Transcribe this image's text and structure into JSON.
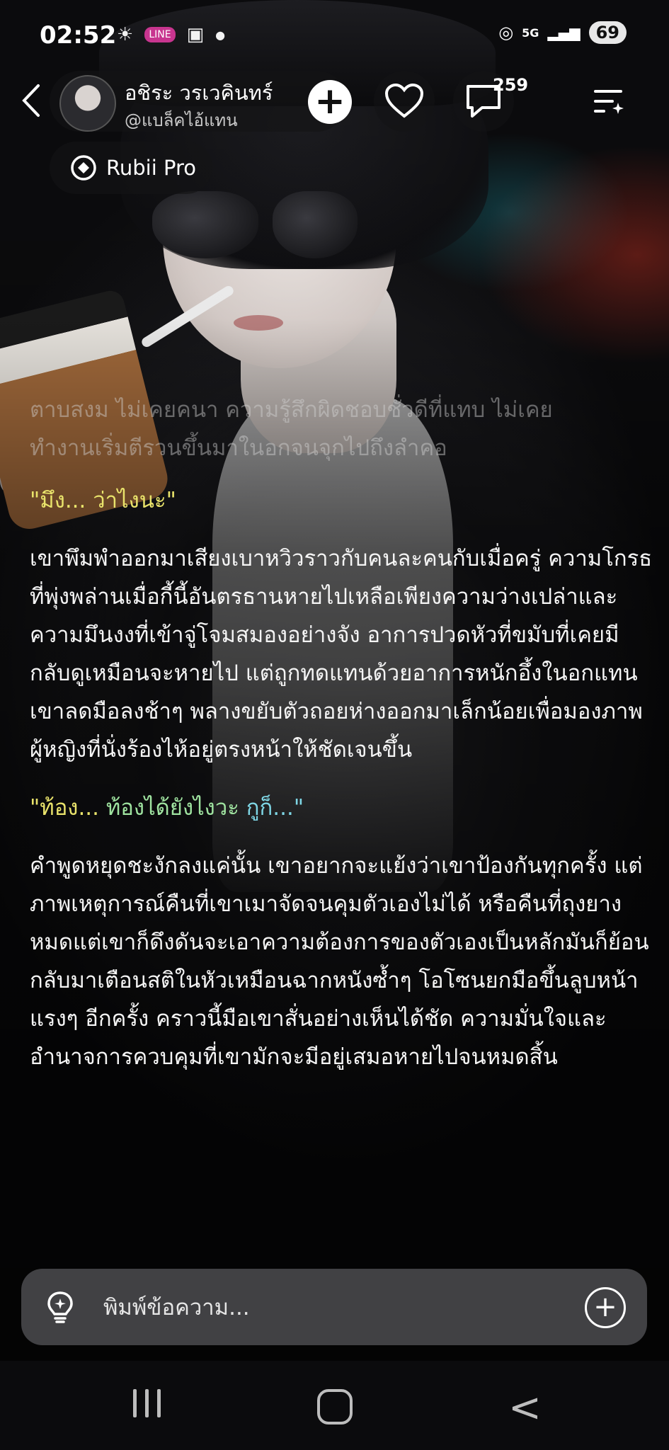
{
  "status_bar": {
    "time": "02:52",
    "line_badge": "LINE",
    "network": "5G",
    "battery": "69"
  },
  "header": {
    "character_name": "อชิระ วรเวคินทร์",
    "character_handle": "@แบล็คไอ้แทน",
    "comment_count": "259",
    "model_label": "Rubii Pro"
  },
  "story": {
    "faded_lines": "ตาบสงม ไม่เคยคนา ความรู้สึกผิดชอบชั่วดีที่แทบ ไม่เคย\nทำงานเริ่มตีรวนขึ้นมาในอกจนจุกไปถึงลำคอ",
    "dialog_1": "\"มึง... ว่าไงนะ\"",
    "paragraph_1": "เขาพึมพำออกมาเสียงเบาหวิวราวกับคนละคนกับเมื่อครู่ ความโกรธที่พุ่งพล่านเมื่อกี้นี้อันตรธานหายไปเหลือเพียงความว่างเปล่าและความมึนงงที่เข้าจู่โจมสมองอย่างจัง อาการปวดหัวที่ขมับที่เคยมีกลับดูเหมือนจะหายไป แต่ถูกทดแทนด้วยอาการหนักอึ้งในอกแทน เขาลดมือลงช้าๆ พลางขยับตัวถอยห่างออกมาเล็กน้อยเพื่อมองภาพผู้หญิงที่นั่งร้องไห้อยู่ตรงหน้าให้ชัดเจนขึ้น",
    "dialog_2_a": "\"ท้อง... ",
    "dialog_2_b": "ท้องได้ยังไงวะ ",
    "dialog_2_c": "กูก็...\"",
    "paragraph_2": "คำพูดหยุดชะงักลงแค่นั้น เขาอยากจะแย้งว่าเขาป้องกันทุกครั้ง แต่ภาพเหตุการณ์คืนที่เขาเมาจัดจนคุมตัวเองไม่ได้ หรือคืนที่ถุงยางหมดแต่เขาก็ดึงดันจะเอาความต้องการของตัวเองเป็นหลักมันก็ย้อนกลับมาเตือนสติในหัวเหมือนฉากหนังซ้ำๆ โอโซนยกมือขึ้นลูบหน้าแรงๆ อีกครั้ง คราวนี้มือเขาสั่นอย่างเห็นได้ชัด ความมั่นใจและอำนาจการควบคุมที่เขามักจะมีอยู่เสมอหายไปจนหมดสิ้น"
  },
  "composer": {
    "placeholder": "พิมพ์ข้อความ..."
  },
  "icons": {
    "back": "chevron-left-icon",
    "add": "plus-icon",
    "like": "heart-icon",
    "comments": "comment-icon",
    "menu": "menu-sparkle-icon",
    "model": "rubii-icon",
    "suggest": "lightbulb-icon",
    "attach": "plus-circle-icon"
  },
  "colors": {
    "dialog_yellow": "#e9e36b",
    "dialog_green": "#9fe3a0",
    "dialog_cyan": "#7fd7e6",
    "input_bg": "#46464a"
  }
}
